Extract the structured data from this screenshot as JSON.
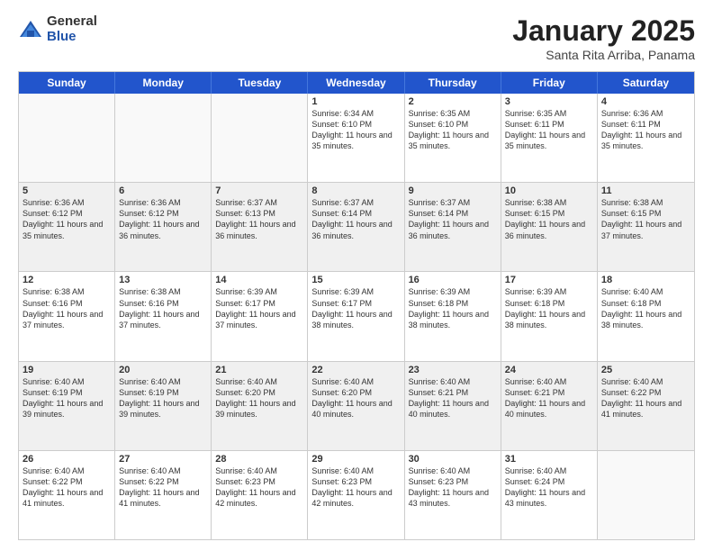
{
  "logo": {
    "general": "General",
    "blue": "Blue"
  },
  "title": {
    "month": "January 2025",
    "location": "Santa Rita Arriba, Panama"
  },
  "header": {
    "days": [
      "Sunday",
      "Monday",
      "Tuesday",
      "Wednesday",
      "Thursday",
      "Friday",
      "Saturday"
    ]
  },
  "weeks": [
    [
      {
        "day": "",
        "info": ""
      },
      {
        "day": "",
        "info": ""
      },
      {
        "day": "",
        "info": ""
      },
      {
        "day": "1",
        "info": "Sunrise: 6:34 AM\nSunset: 6:10 PM\nDaylight: 11 hours\nand 35 minutes."
      },
      {
        "day": "2",
        "info": "Sunrise: 6:35 AM\nSunset: 6:10 PM\nDaylight: 11 hours\nand 35 minutes."
      },
      {
        "day": "3",
        "info": "Sunrise: 6:35 AM\nSunset: 6:11 PM\nDaylight: 11 hours\nand 35 minutes."
      },
      {
        "day": "4",
        "info": "Sunrise: 6:36 AM\nSunset: 6:11 PM\nDaylight: 11 hours\nand 35 minutes."
      }
    ],
    [
      {
        "day": "5",
        "info": "Sunrise: 6:36 AM\nSunset: 6:12 PM\nDaylight: 11 hours\nand 35 minutes."
      },
      {
        "day": "6",
        "info": "Sunrise: 6:36 AM\nSunset: 6:12 PM\nDaylight: 11 hours\nand 36 minutes."
      },
      {
        "day": "7",
        "info": "Sunrise: 6:37 AM\nSunset: 6:13 PM\nDaylight: 11 hours\nand 36 minutes."
      },
      {
        "day": "8",
        "info": "Sunrise: 6:37 AM\nSunset: 6:14 PM\nDaylight: 11 hours\nand 36 minutes."
      },
      {
        "day": "9",
        "info": "Sunrise: 6:37 AM\nSunset: 6:14 PM\nDaylight: 11 hours\nand 36 minutes."
      },
      {
        "day": "10",
        "info": "Sunrise: 6:38 AM\nSunset: 6:15 PM\nDaylight: 11 hours\nand 36 minutes."
      },
      {
        "day": "11",
        "info": "Sunrise: 6:38 AM\nSunset: 6:15 PM\nDaylight: 11 hours\nand 37 minutes."
      }
    ],
    [
      {
        "day": "12",
        "info": "Sunrise: 6:38 AM\nSunset: 6:16 PM\nDaylight: 11 hours\nand 37 minutes."
      },
      {
        "day": "13",
        "info": "Sunrise: 6:38 AM\nSunset: 6:16 PM\nDaylight: 11 hours\nand 37 minutes."
      },
      {
        "day": "14",
        "info": "Sunrise: 6:39 AM\nSunset: 6:17 PM\nDaylight: 11 hours\nand 37 minutes."
      },
      {
        "day": "15",
        "info": "Sunrise: 6:39 AM\nSunset: 6:17 PM\nDaylight: 11 hours\nand 38 minutes."
      },
      {
        "day": "16",
        "info": "Sunrise: 6:39 AM\nSunset: 6:18 PM\nDaylight: 11 hours\nand 38 minutes."
      },
      {
        "day": "17",
        "info": "Sunrise: 6:39 AM\nSunset: 6:18 PM\nDaylight: 11 hours\nand 38 minutes."
      },
      {
        "day": "18",
        "info": "Sunrise: 6:40 AM\nSunset: 6:18 PM\nDaylight: 11 hours\nand 38 minutes."
      }
    ],
    [
      {
        "day": "19",
        "info": "Sunrise: 6:40 AM\nSunset: 6:19 PM\nDaylight: 11 hours\nand 39 minutes."
      },
      {
        "day": "20",
        "info": "Sunrise: 6:40 AM\nSunset: 6:19 PM\nDaylight: 11 hours\nand 39 minutes."
      },
      {
        "day": "21",
        "info": "Sunrise: 6:40 AM\nSunset: 6:20 PM\nDaylight: 11 hours\nand 39 minutes."
      },
      {
        "day": "22",
        "info": "Sunrise: 6:40 AM\nSunset: 6:20 PM\nDaylight: 11 hours\nand 40 minutes."
      },
      {
        "day": "23",
        "info": "Sunrise: 6:40 AM\nSunset: 6:21 PM\nDaylight: 11 hours\nand 40 minutes."
      },
      {
        "day": "24",
        "info": "Sunrise: 6:40 AM\nSunset: 6:21 PM\nDaylight: 11 hours\nand 40 minutes."
      },
      {
        "day": "25",
        "info": "Sunrise: 6:40 AM\nSunset: 6:22 PM\nDaylight: 11 hours\nand 41 minutes."
      }
    ],
    [
      {
        "day": "26",
        "info": "Sunrise: 6:40 AM\nSunset: 6:22 PM\nDaylight: 11 hours\nand 41 minutes."
      },
      {
        "day": "27",
        "info": "Sunrise: 6:40 AM\nSunset: 6:22 PM\nDaylight: 11 hours\nand 41 minutes."
      },
      {
        "day": "28",
        "info": "Sunrise: 6:40 AM\nSunset: 6:23 PM\nDaylight: 11 hours\nand 42 minutes."
      },
      {
        "day": "29",
        "info": "Sunrise: 6:40 AM\nSunset: 6:23 PM\nDaylight: 11 hours\nand 42 minutes."
      },
      {
        "day": "30",
        "info": "Sunrise: 6:40 AM\nSunset: 6:23 PM\nDaylight: 11 hours\nand 43 minutes."
      },
      {
        "day": "31",
        "info": "Sunrise: 6:40 AM\nSunset: 6:24 PM\nDaylight: 11 hours\nand 43 minutes."
      },
      {
        "day": "",
        "info": ""
      }
    ]
  ]
}
